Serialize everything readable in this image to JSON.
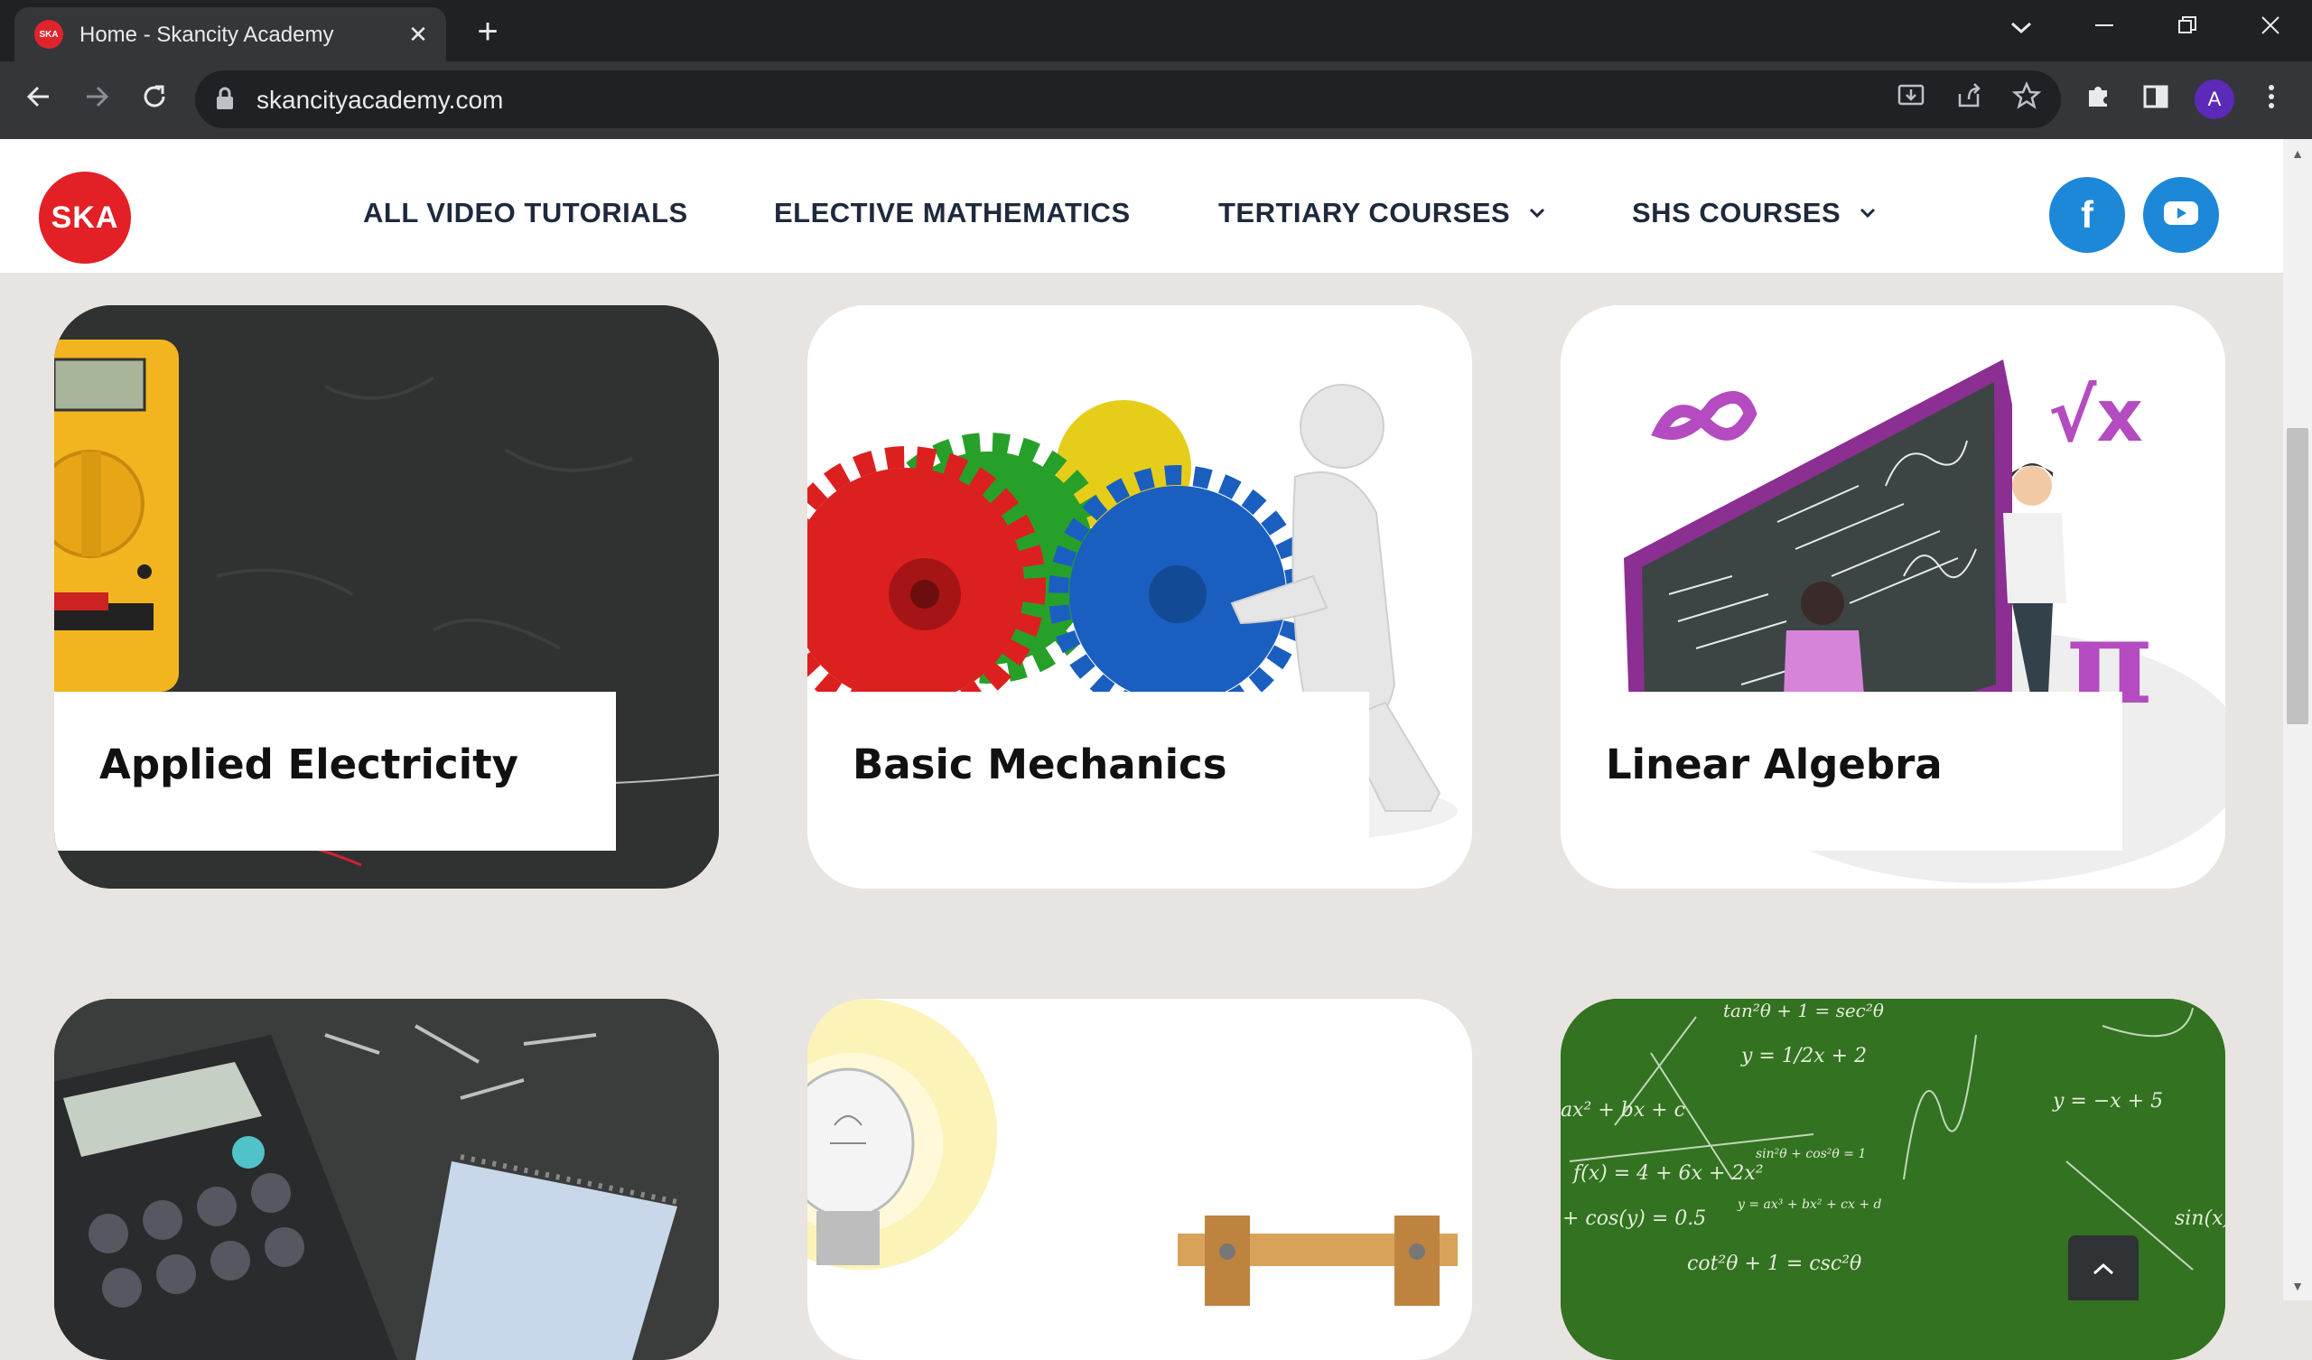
{
  "browser": {
    "tab_title": "Home - Skancity Academy",
    "favicon_text": "SKA",
    "url": "skancityacademy.com",
    "profile_initial": "A",
    "tab_close": "✕",
    "new_tab": "+"
  },
  "site": {
    "logo_text": "SKA",
    "nav": [
      {
        "label": "ALL VIDEO TUTORIALS",
        "has_dropdown": false
      },
      {
        "label": "ELECTIVE MATHEMATICS",
        "has_dropdown": false
      },
      {
        "label": "TERTIARY COURSES",
        "has_dropdown": true
      },
      {
        "label": "SHS COURSES",
        "has_dropdown": true
      }
    ],
    "social": [
      {
        "icon": "facebook-icon",
        "glyph": "f"
      },
      {
        "icon": "youtube-icon",
        "glyph": "▶"
      }
    ],
    "brand_red": "#e22026",
    "social_blue": "#1e88d8"
  },
  "courses": [
    {
      "title": "Applied Electricity",
      "image": "multimeter-on-chalkboard"
    },
    {
      "title": "Basic Mechanics",
      "image": "gears-and-figure"
    },
    {
      "title": "Linear Algebra",
      "image": "math-classroom-illustration"
    },
    {
      "title": "",
      "image": "calculator-and-notepad"
    },
    {
      "title": "",
      "image": "light-bulb-circuit"
    },
    {
      "title": "",
      "image": "green-chalkboard-equations"
    }
  ],
  "chalk_equations": [
    "tan²θ + 1 = sec²θ",
    "y = 1/2x + 2",
    "ax² + bx + c",
    "f(x) = 4 + 6x + 2x²",
    "+ cos(y) = 0.5",
    "y = −x + 5",
    "sin(x)",
    "cot²θ + 1 = csc²θ",
    "y = ax³ + bx² + cx + d",
    "sin²θ + cos²θ = 1"
  ],
  "back_to_top": "⌃"
}
